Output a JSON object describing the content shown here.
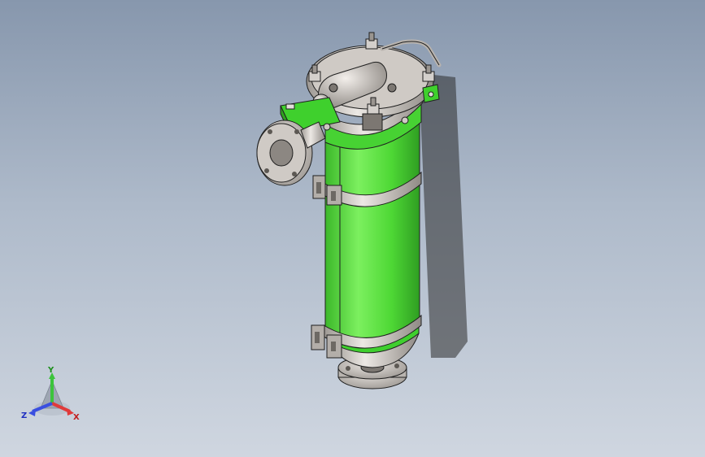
{
  "viewport": {
    "background_top": "#8797ad",
    "background_bottom": "#cfd6e0"
  },
  "model": {
    "body_color": "#4ed835",
    "metal_color": "#c9c4bf",
    "edge_color": "#1f1f1f"
  },
  "triad": {
    "y_label": "Y",
    "x_label": "X",
    "z_label": "Z",
    "y_color": "#3cc43c",
    "x_color": "#e03a3a",
    "z_color": "#3a4fe0"
  }
}
